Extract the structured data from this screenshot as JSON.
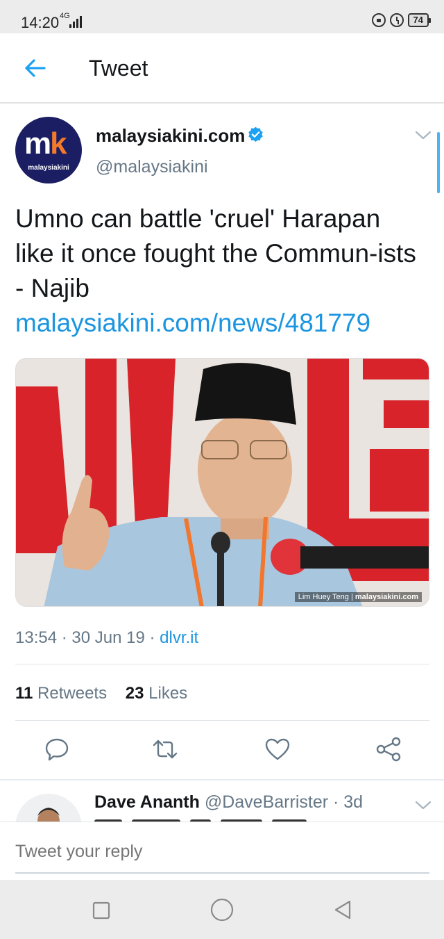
{
  "status_bar": {
    "time": "14:20",
    "network": "4G",
    "battery": "74",
    "icons": [
      "lock-rotation-icon",
      "alarm-icon",
      "battery-icon"
    ]
  },
  "header": {
    "title": "Tweet",
    "back_icon": "arrow-left-icon"
  },
  "tweet": {
    "avatar_text": "mk",
    "avatar_brand": "malaysiakini",
    "author_name": "malaysiakini.com",
    "handle": "@malaysiakini",
    "verified": true,
    "text": "Umno can battle 'cruel' Harapan like it once fought the Commun-ists - Najib ",
    "link": "malaysiakini.com/news/481779",
    "photo_credit_name": "Lim Huey Teng",
    "photo_credit_site": "malaysiakini.com",
    "time": "13:54",
    "date": "30 Jun 19",
    "source": "dlvr.it",
    "retweets_count": "11",
    "retweets_label": "Retweets",
    "likes_count": "23",
    "likes_label": "Likes"
  },
  "actions": [
    "reply-icon",
    "retweet-icon",
    "like-icon",
    "share-icon"
  ],
  "reply": {
    "name": "Dave Ananth",
    "handle": "@DaveBarrister",
    "time": "3d"
  },
  "composer": {
    "placeholder": "Tweet your reply"
  },
  "nav": [
    "recents-icon",
    "home-icon",
    "back-icon"
  ],
  "colors": {
    "link_blue": "#1b95e0",
    "muted_gray": "#657786",
    "avatar_navy": "#1b1e63",
    "avatar_orange": "#f47a2a"
  }
}
